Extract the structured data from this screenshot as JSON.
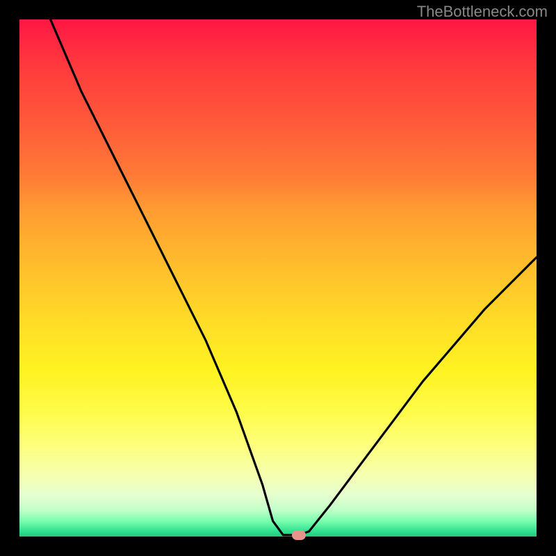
{
  "watermark": "TheBottleneck.com",
  "chart_data": {
    "type": "line",
    "title": "",
    "xlabel": "",
    "ylabel": "",
    "xlim": [
      0,
      100
    ],
    "ylim": [
      0,
      100
    ],
    "background_gradient": {
      "top": "#ff1744",
      "orange": "#ff9832",
      "yellow": "#fff322",
      "bottom": "#22c877"
    },
    "curve_points": [
      {
        "x": 6,
        "y": 100
      },
      {
        "x": 12,
        "y": 86
      },
      {
        "x": 18,
        "y": 74
      },
      {
        "x": 24,
        "y": 62
      },
      {
        "x": 30,
        "y": 50
      },
      {
        "x": 36,
        "y": 38
      },
      {
        "x": 42,
        "y": 24
      },
      {
        "x": 47,
        "y": 10
      },
      {
        "x": 49,
        "y": 3
      },
      {
        "x": 51,
        "y": 0.3
      },
      {
        "x": 54,
        "y": 0.3
      },
      {
        "x": 56,
        "y": 1
      },
      {
        "x": 60,
        "y": 6
      },
      {
        "x": 66,
        "y": 14
      },
      {
        "x": 72,
        "y": 22
      },
      {
        "x": 78,
        "y": 30
      },
      {
        "x": 84,
        "y": 37
      },
      {
        "x": 90,
        "y": 44
      },
      {
        "x": 96,
        "y": 50
      },
      {
        "x": 100,
        "y": 54
      }
    ],
    "marker": {
      "x": 54,
      "y": 0.3,
      "color": "#e6948c"
    }
  }
}
